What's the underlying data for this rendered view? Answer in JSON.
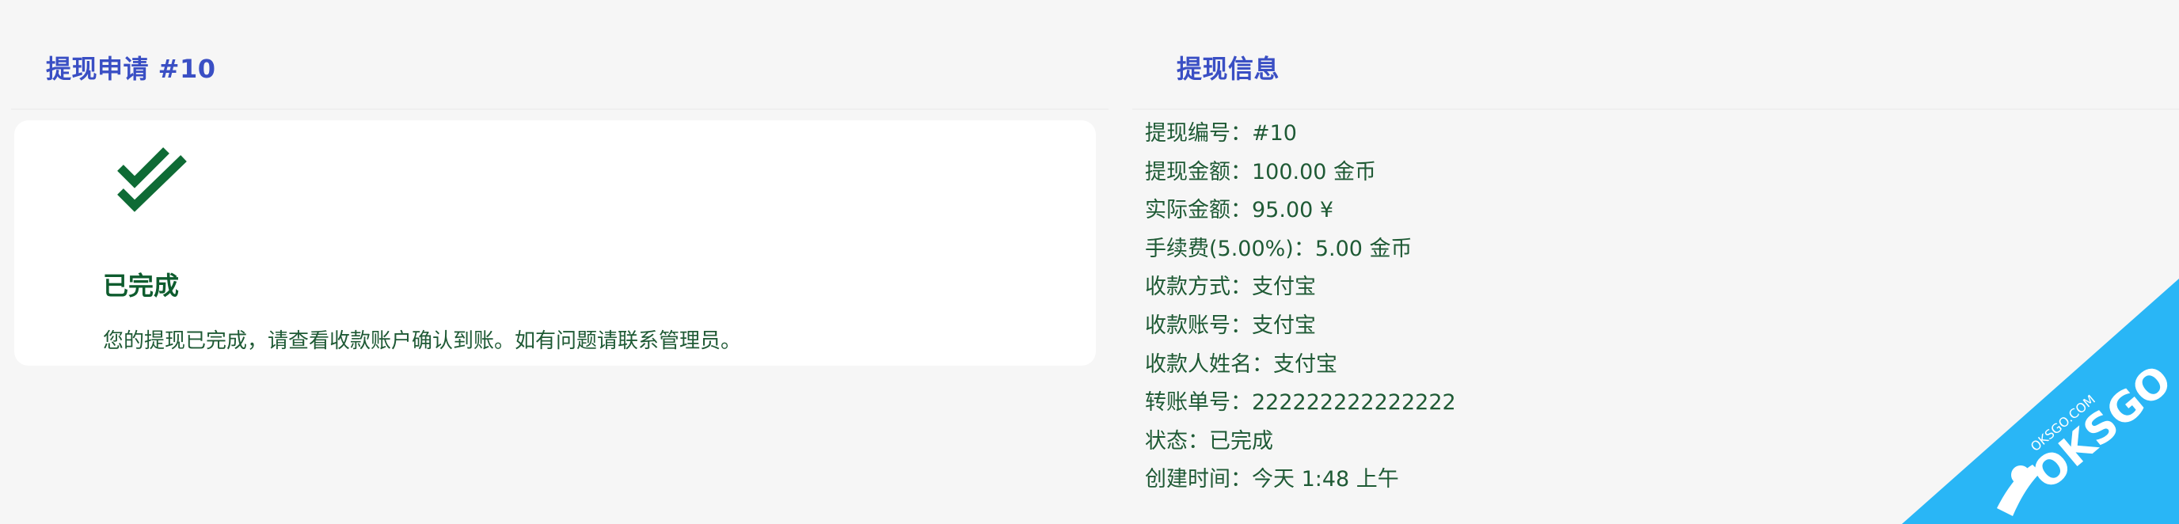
{
  "left_panel": {
    "title": "提现申请 #10",
    "status_card": {
      "icon": "double-check-icon",
      "status": "已完成",
      "description": "您的提现已完成，请查看收款账户确认到账。如有问题请联系管理员。",
      "accent_color": "#0e6b35"
    }
  },
  "right_panel": {
    "title": "提现信息",
    "rows": [
      "提现编号：#10",
      "提现金额：100.00 金币",
      "实际金额：95.00 ¥",
      "手续费(5.00%)：5.00 金币",
      "收款方式：支付宝",
      "收款账号：支付宝",
      "收款人姓名：支付宝",
      "转账单号：222222222222222",
      "状态：已完成",
      "创建时间：今天 1:48 上午"
    ]
  },
  "watermark": {
    "text": "OKSGO",
    "subtext": "OKSGO.COM",
    "color": "#29b6f6"
  },
  "colors": {
    "title_blue": "#3a4fc4",
    "text_green": "#1f5a35",
    "background": "#f6f6f6"
  }
}
